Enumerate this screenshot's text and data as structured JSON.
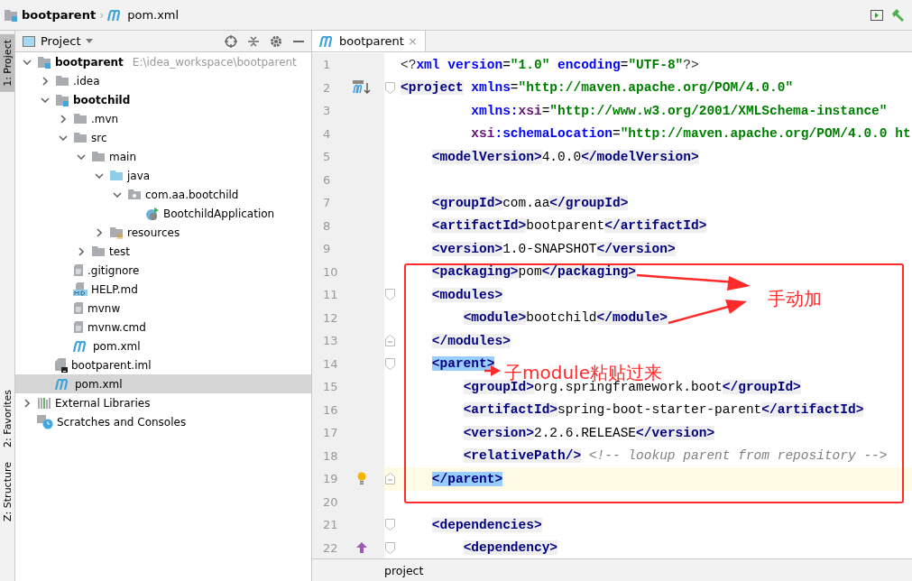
{
  "breadcrumb": [
    {
      "kind": "module",
      "label": "bootparent"
    },
    {
      "kind": "maven",
      "separator": "›",
      "label": "pom.xml"
    }
  ],
  "tool_stripe": [
    {
      "label": "1: Project",
      "selected": true
    },
    {
      "label": "2: Favorites",
      "selected": false
    },
    {
      "label": "Z: Structure",
      "selected": false
    }
  ],
  "project_panel": {
    "title": "Project",
    "tree": [
      {
        "label": "bootparent",
        "hint": "E:\\idea_workspace\\bootparent",
        "kind": "module",
        "bold": true,
        "expanded": true,
        "selected": false,
        "children": [
          {
            "label": ".idea",
            "kind": "folder",
            "bold": false,
            "expanded": false,
            "selected": false
          },
          {
            "label": "bootchild",
            "kind": "module",
            "bold": true,
            "expanded": true,
            "selected": false,
            "children": [
              {
                "label": ".mvn",
                "kind": "folder",
                "bold": false,
                "expanded": false,
                "selected": false
              },
              {
                "label": "src",
                "kind": "folder",
                "bold": false,
                "expanded": true,
                "selected": false,
                "children": [
                  {
                    "label": "main",
                    "kind": "folder",
                    "bold": false,
                    "expanded": true,
                    "selected": false,
                    "children": [
                      {
                        "label": "java",
                        "kind": "source",
                        "bold": false,
                        "expanded": true,
                        "selected": false,
                        "children": [
                          {
                            "label": "com.aa.bootchild",
                            "kind": "package",
                            "bold": false,
                            "expanded": true,
                            "selected": false,
                            "children": [
                              {
                                "label": "BootchildApplication",
                                "kind": "springclass",
                                "bold": false,
                                "selected": false
                              }
                            ]
                          }
                        ]
                      },
                      {
                        "label": "resources",
                        "kind": "resources",
                        "bold": false,
                        "expanded": false,
                        "selected": false
                      }
                    ]
                  },
                  {
                    "label": "test",
                    "kind": "folder",
                    "bold": false,
                    "expanded": false,
                    "selected": false
                  }
                ]
              },
              {
                "label": ".gitignore",
                "kind": "text",
                "bold": false,
                "selected": false
              },
              {
                "label": "HELP.md",
                "kind": "md",
                "bold": false,
                "selected": false
              },
              {
                "label": "mvnw",
                "kind": "text",
                "bold": false,
                "selected": false
              },
              {
                "label": "mvnw.cmd",
                "kind": "text",
                "bold": false,
                "selected": false
              },
              {
                "label": "pom.xml",
                "kind": "maven",
                "bold": false,
                "selected": false
              }
            ]
          },
          {
            "label": "bootparent.iml",
            "kind": "iml",
            "bold": false,
            "selected": false
          },
          {
            "label": "pom.xml",
            "kind": "maven",
            "bold": false,
            "selected": true
          }
        ]
      },
      {
        "label": "External Libraries",
        "kind": "libraries",
        "bold": false,
        "expanded": false,
        "selected": false
      },
      {
        "label": "Scratches and Consoles",
        "kind": "scratches",
        "bold": false,
        "selected": false
      }
    ]
  },
  "editor": {
    "tabs": [
      {
        "label": "bootparent",
        "close": "×",
        "selected": true
      }
    ],
    "lines": [
      {
        "number": "1",
        "current": false,
        "segments": [
          {
            "kind": "pi",
            "text": "<?"
          },
          {
            "kind": "attr",
            "text": "xml"
          },
          {
            "kind": "attr",
            "text": " version"
          },
          {
            "kind": "text",
            "text": "="
          },
          {
            "kind": "value",
            "text": "\"1.0\""
          },
          {
            "kind": "attr",
            "text": " encoding"
          },
          {
            "kind": "text",
            "text": "="
          },
          {
            "kind": "value",
            "text": "\"UTF-8\""
          },
          {
            "kind": "pi",
            "text": "?>"
          }
        ]
      },
      {
        "number": "2",
        "current": false,
        "marker": {
          "kind": "maven"
        },
        "fold": {
          "kind": "start"
        },
        "segments": [
          {
            "kind": "tag",
            "text": "<project"
          },
          {
            "kind": "attr",
            "text": " xmlns"
          },
          {
            "kind": "text",
            "text": "="
          },
          {
            "kind": "value",
            "text": "\"http://maven.apache.org/POM/4.0.0\""
          }
        ]
      },
      {
        "number": "3",
        "current": false,
        "segments": [
          {
            "kind": "attr",
            "text": "         xmlns:"
          },
          {
            "kind": "ns",
            "text": "xsi"
          },
          {
            "kind": "text",
            "text": "="
          },
          {
            "kind": "value",
            "text": "\"http://www.w3.org/2001/XMLSchema-instance\""
          }
        ]
      },
      {
        "number": "4",
        "current": false,
        "segments": [
          {
            "kind": "ns",
            "text": "         xsi"
          },
          {
            "kind": "attr",
            "text": ":schemaLocation"
          },
          {
            "kind": "text",
            "text": "="
          },
          {
            "kind": "value",
            "text": "\"http://maven.apache.org/POM/4.0.0 ht"
          }
        ]
      },
      {
        "number": "5",
        "current": false,
        "segments": [
          {
            "kind": "tag",
            "text": "    <modelVersion>"
          },
          {
            "kind": "text",
            "text": "4.0.0"
          },
          {
            "kind": "tag",
            "text": "</modelVersion>"
          }
        ]
      },
      {
        "number": "6",
        "current": false
      },
      {
        "number": "7",
        "current": false,
        "segments": [
          {
            "kind": "tag",
            "text": "    <groupId>"
          },
          {
            "kind": "text",
            "text": "com.aa"
          },
          {
            "kind": "tag",
            "text": "</groupId>"
          }
        ]
      },
      {
        "number": "8",
        "current": false,
        "segments": [
          {
            "kind": "tag",
            "text": "    <artifactId>"
          },
          {
            "kind": "text",
            "text": "bootparent"
          },
          {
            "kind": "tag",
            "text": "</artifactId>"
          }
        ]
      },
      {
        "number": "9",
        "current": false,
        "segments": [
          {
            "kind": "tag",
            "text": "    <version>"
          },
          {
            "kind": "text",
            "text": "1.0-SNAPSHOT"
          },
          {
            "kind": "tag",
            "text": "</version>"
          }
        ]
      },
      {
        "number": "10",
        "current": false,
        "segments": [
          {
            "kind": "tag",
            "text": "    <packaging>"
          },
          {
            "kind": "text",
            "text": "pom"
          },
          {
            "kind": "tag",
            "text": "</packaging>"
          }
        ]
      },
      {
        "number": "11",
        "current": false,
        "fold": {
          "kind": "start"
        },
        "segments": [
          {
            "kind": "tag",
            "text": "    <modules>"
          }
        ]
      },
      {
        "number": "12",
        "current": false,
        "segments": [
          {
            "kind": "tag",
            "text": "        <module>"
          },
          {
            "kind": "text",
            "text": "bootchild"
          },
          {
            "kind": "tag",
            "text": "</module>"
          }
        ]
      },
      {
        "number": "13",
        "current": false,
        "fold": {
          "kind": "end"
        },
        "segments": [
          {
            "kind": "tag",
            "text": "    </modules>"
          }
        ]
      },
      {
        "number": "14",
        "current": false,
        "fold": {
          "kind": "start"
        },
        "segments": [
          {
            "kind": "match",
            "text": "    <parent>"
          }
        ]
      },
      {
        "number": "15",
        "current": false,
        "segments": [
          {
            "kind": "tag",
            "text": "        <groupId>"
          },
          {
            "kind": "text",
            "text": "org.springframework.boot"
          },
          {
            "kind": "tag",
            "text": "</groupId>"
          }
        ]
      },
      {
        "number": "16",
        "current": false,
        "segments": [
          {
            "kind": "tag",
            "text": "        <artifactId>"
          },
          {
            "kind": "text",
            "text": "spring-boot-starter-parent"
          },
          {
            "kind": "tag",
            "text": "</artifactId>"
          }
        ]
      },
      {
        "number": "17",
        "current": false,
        "segments": [
          {
            "kind": "tag",
            "text": "        <version>"
          },
          {
            "kind": "text",
            "text": "2.2.6.RELEASE"
          },
          {
            "kind": "tag",
            "text": "</version>"
          }
        ]
      },
      {
        "number": "18",
        "current": false,
        "segments": [
          {
            "kind": "tag",
            "text": "        <relativePath/>"
          },
          {
            "kind": "comment",
            "text": " <!-- lookup parent from repository -->"
          }
        ]
      },
      {
        "number": "19",
        "current": true,
        "marker": {
          "kind": "bulb"
        },
        "fold": {
          "kind": "end"
        },
        "segments": [
          {
            "kind": "match",
            "text": "    </parent>"
          }
        ]
      },
      {
        "number": "20",
        "current": false
      },
      {
        "number": "21",
        "current": false,
        "fold": {
          "kind": "start"
        },
        "segments": [
          {
            "kind": "tag",
            "text": "    <dependencies>"
          }
        ]
      },
      {
        "number": "22",
        "current": false,
        "marker": {
          "kind": "override"
        },
        "fold": {
          "kind": "start"
        },
        "segments": [
          {
            "kind": "tag",
            "text": "        <dependency>"
          }
        ]
      }
    ],
    "path": "project"
  },
  "annotations": [
    {
      "kind": "note",
      "text": "手动加"
    },
    {
      "kind": "note",
      "text": "子module粘贴过来"
    }
  ]
}
